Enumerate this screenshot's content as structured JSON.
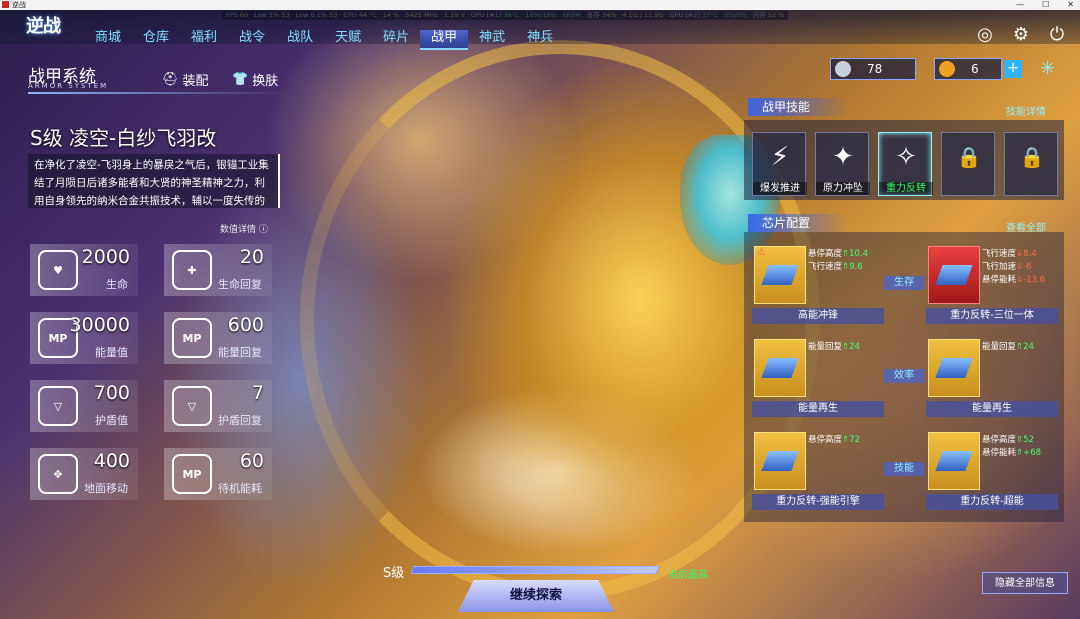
{
  "window": {
    "title": "逆战"
  },
  "perf": [
    {
      "lbl": "FPS",
      "val": "60"
    },
    {
      "lbl": "Low 1%",
      "val": "53"
    },
    {
      "lbl": "Low 0.1%",
      "val": "53"
    },
    {
      "lbl": "CPU",
      "val": "44 °C"
    },
    {
      "lbl": "",
      "val": "14 %"
    },
    {
      "lbl": "",
      "val": "5425 MHz"
    },
    {
      "lbl": "",
      "val": "1.19 V"
    },
    {
      "lbl": "GPU [#1]",
      "val": "39°C"
    },
    {
      "lbl": "",
      "val": "18%/19%"
    },
    {
      "lbl": "",
      "val": "0RPM"
    },
    {
      "lbl": "显存",
      "val": "34%"
    },
    {
      "lbl": "",
      "val": "4.1G / 11.9G"
    },
    {
      "lbl": "GPU [#2]",
      "val": "37°C"
    },
    {
      "lbl": "",
      "val": "0%/0%"
    },
    {
      "lbl": "内存",
      "val": "52 %"
    }
  ],
  "logo": "逆战",
  "nav": [
    "商城",
    "仓库",
    "福利",
    "战令",
    "战队",
    "天赋",
    "碎片",
    "战甲",
    "神武",
    "神兵"
  ],
  "nav_active": "战甲",
  "icons": {
    "top": [
      "radar-icon",
      "gear-icon",
      "power-icon"
    ]
  },
  "system": {
    "title": "战甲系统",
    "subtitle": "ARMOR SYSTEM",
    "equip": "装配",
    "skin": "换肤"
  },
  "armor": {
    "name": "S级 凌空-白纱飞羽改",
    "desc": "在净化了凌空-飞羽身上的暴戾之气后，银锚工业集结了月陨日后诸多能者和大贤的神圣精神之力，利用自身领先的纳米合金共振技术，辅以一度失传的神秘",
    "detail": "数值详情"
  },
  "stats": [
    {
      "value": "2000",
      "label": "生命",
      "icon": "♥"
    },
    {
      "value": "20",
      "label": "生命回复",
      "icon": "✚"
    },
    {
      "value": "30000",
      "label": "能量值",
      "icon": "MP"
    },
    {
      "value": "600",
      "label": "能量回复",
      "icon": "MP"
    },
    {
      "value": "700",
      "label": "护盾值",
      "icon": "▽"
    },
    {
      "value": "7",
      "label": "护盾回复",
      "icon": "▽"
    },
    {
      "value": "400",
      "label": "地面移动",
      "icon": "✥"
    },
    {
      "value": "60",
      "label": "待机能耗",
      "icon": "MP"
    }
  ],
  "currency": [
    {
      "value": "78",
      "color": "#c8d0e0"
    },
    {
      "value": "6",
      "color": "#f0a020"
    }
  ],
  "skills": {
    "header": "战甲技能",
    "link": "技能详情",
    "items": [
      {
        "label": "爆发推进",
        "icon": "⚡",
        "state": "normal"
      },
      {
        "label": "原力冲坠",
        "icon": "✦",
        "state": "normal"
      },
      {
        "label": "重力反转",
        "icon": "✧",
        "state": "selected"
      },
      {
        "label": "",
        "icon": "🔒",
        "state": "locked"
      },
      {
        "label": "",
        "icon": "🔒",
        "state": "locked"
      }
    ]
  },
  "chips": {
    "header": "芯片配置",
    "link": "查看全部",
    "row_tags": [
      "生存",
      "效率",
      "技能"
    ],
    "items": [
      {
        "name": "高能冲锋",
        "red": false,
        "warn": true,
        "stats": [
          {
            "t": "悬停高度",
            "v": "10.4",
            "d": "up"
          },
          {
            "t": "飞行速度",
            "v": "9.6",
            "d": "up"
          }
        ]
      },
      {
        "name": "重力反转-三位一体",
        "red": true,
        "warn": true,
        "stats": [
          {
            "t": "飞行速度",
            "v": "8.4",
            "d": "dn"
          },
          {
            "t": "飞行加速",
            "v": "-6",
            "d": "dn"
          },
          {
            "t": "悬停能耗",
            "v": "-13.6",
            "d": "dn"
          }
        ]
      },
      {
        "name": "能量再生",
        "red": false,
        "warn": false,
        "stats": [
          {
            "t": "能量回复",
            "v": "24",
            "d": "up"
          }
        ]
      },
      {
        "name": "能量再生",
        "red": false,
        "warn": false,
        "stats": [
          {
            "t": "能量回复",
            "v": "24",
            "d": "up"
          }
        ]
      },
      {
        "name": "重力反转-强能引擎",
        "red": false,
        "warn": false,
        "stats": [
          {
            "t": "悬停高度",
            "v": "72",
            "d": "up"
          }
        ]
      },
      {
        "name": "重力反转-超能",
        "red": false,
        "warn": false,
        "stats": [
          {
            "t": "悬停高度",
            "v": "52",
            "d": "up"
          },
          {
            "t": "悬停能耗",
            "v": "+68",
            "d": "up"
          }
        ]
      }
    ]
  },
  "grade": {
    "label": "S级",
    "max_text": "当前最高",
    "progress": 1.0
  },
  "bottom": {
    "continue": "继续探索",
    "hide_all": "隐藏全部信息"
  }
}
